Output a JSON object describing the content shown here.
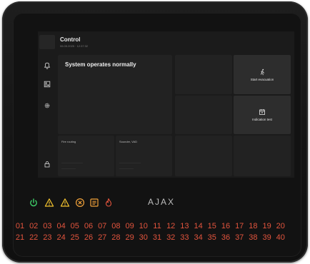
{
  "screen": {
    "title": "Control",
    "datetime": "06.05.2025 · 12:37:32",
    "status": "System operates normally",
    "panels": {
      "fire_routing": "Fire routing",
      "sounder": "Sounder, VAD"
    },
    "buttons": {
      "evacuation": "Start evacuation",
      "indication": "Indication test"
    }
  },
  "sidebar_icons": [
    "bell-icon",
    "panel-icon",
    "gear-icon",
    "lock-icon"
  ],
  "indicators": [
    {
      "name": "power-indicator-icon",
      "color": "#3fd16a"
    },
    {
      "name": "warning-indicator-icon",
      "color": "#f2c22e"
    },
    {
      "name": "warning-indicator-icon-2",
      "color": "#f2c22e"
    },
    {
      "name": "fault-indicator-icon",
      "color": "#f2a23a"
    },
    {
      "name": "disabled-indicator-icon",
      "color": "#f2a23a"
    },
    {
      "name": "fire-indicator-icon",
      "color": "#e2543d"
    }
  ],
  "brand": "AJAX",
  "zones_row1": [
    "01",
    "02",
    "03",
    "04",
    "05",
    "06",
    "07",
    "08",
    "09",
    "10",
    "11",
    "12",
    "13",
    "14",
    "15",
    "16",
    "17",
    "18",
    "19",
    "20"
  ],
  "zones_row2": [
    "21",
    "22",
    "23",
    "24",
    "25",
    "26",
    "27",
    "28",
    "29",
    "30",
    "31",
    "32",
    "33",
    "34",
    "35",
    "36",
    "37",
    "38",
    "39",
    "40"
  ]
}
